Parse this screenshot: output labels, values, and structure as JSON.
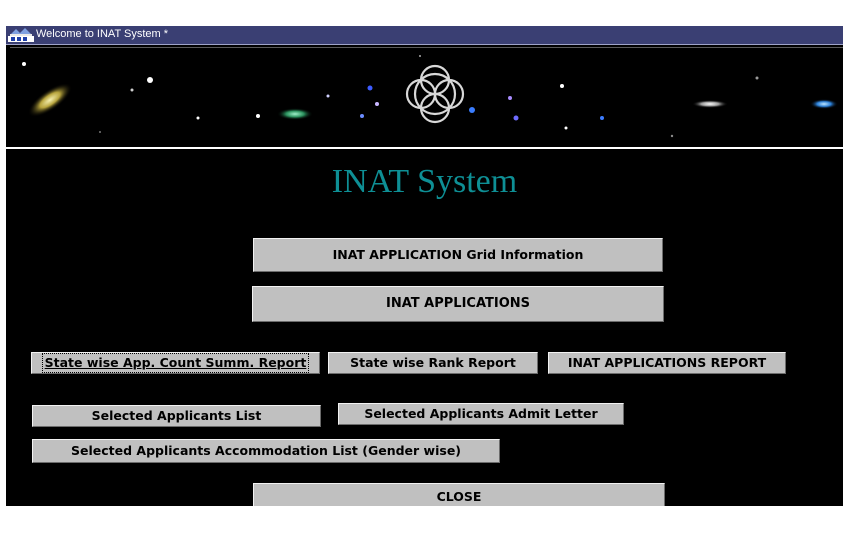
{
  "window": {
    "title": "Welcome to INAT System *"
  },
  "icons": {
    "app_icon": "java-cup-icon",
    "banner_logo": "interlocking-rings-logo"
  },
  "main": {
    "title": "INAT System",
    "title_color": "#0e8f95"
  },
  "buttons": {
    "grid_info": "INAT APPLICATION Grid Information",
    "applications": "INAT APPLICATIONS",
    "state_count_report": "State wise App. Count Summ. Report",
    "state_rank_report": "State wise Rank Report",
    "applications_report": "INAT APPLICATIONS REPORT",
    "selected_list": "Selected Applicants List",
    "admit_letter": "Selected Applicants Admit Letter",
    "accommodation_list": "Selected Applicants Accommodation List (Gender wise)",
    "close": "CLOSE"
  }
}
